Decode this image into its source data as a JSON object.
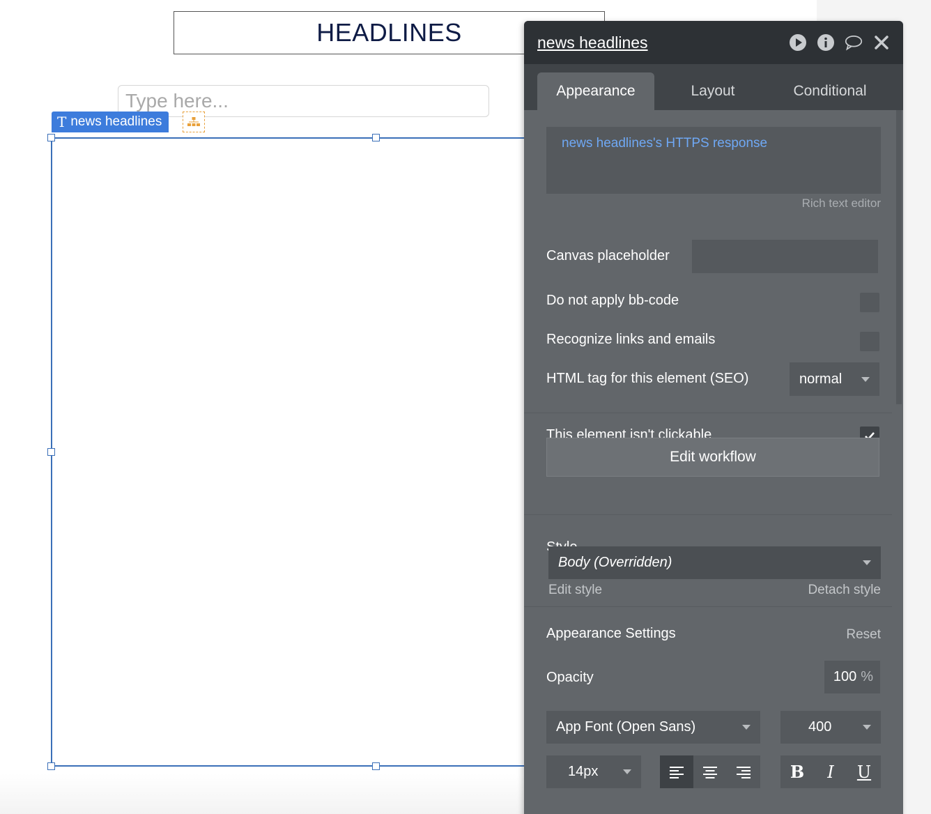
{
  "canvas": {
    "headline_text": "HEADLINES",
    "input_placeholder": "Type here...",
    "selected_element_tag": "news headlines"
  },
  "panel": {
    "title": "news headlines",
    "header_icons": [
      "play-icon",
      "info-icon",
      "comment-icon",
      "close-icon"
    ],
    "tabs": [
      {
        "label": "Appearance",
        "active": true
      },
      {
        "label": "Layout",
        "active": false
      },
      {
        "label": "Conditional",
        "active": false
      }
    ],
    "rich_text_value": "news headlines's HTTPS response",
    "rich_text_caption": "Rich text editor",
    "canvas_placeholder_label": "Canvas placeholder",
    "canvas_placeholder_value": "",
    "bbcode_label": "Do not apply bb-code",
    "bbcode_checked": false,
    "links_label": "Recognize links and emails",
    "links_checked": false,
    "html_tag_label": "HTML tag for this element (SEO)",
    "html_tag_value": "normal",
    "not_clickable_label": "This element isn't clickable",
    "not_clickable_checked": true,
    "edit_workflow_label": "Edit workflow",
    "style_label": "Style",
    "style_value": "Body (Overridden)",
    "edit_style_label": "Edit style",
    "detach_style_label": "Detach style",
    "appearance_settings_label": "Appearance Settings",
    "reset_label": "Reset",
    "opacity_label": "Opacity",
    "opacity_value": "100",
    "opacity_unit": "%",
    "font_value": "App Font (Open Sans)",
    "font_weight_value": "400",
    "font_size_value": "14px",
    "text_align_selected": "left",
    "bold_label": "B",
    "italic_label": "I",
    "underline_label": "U"
  },
  "colors": {
    "accent": "#3d7cdc",
    "panel_bg": "#62666a",
    "panel_header_bg": "#2d3135",
    "link_blue": "#6fa8f4",
    "headline_color": "#0e1b45"
  }
}
